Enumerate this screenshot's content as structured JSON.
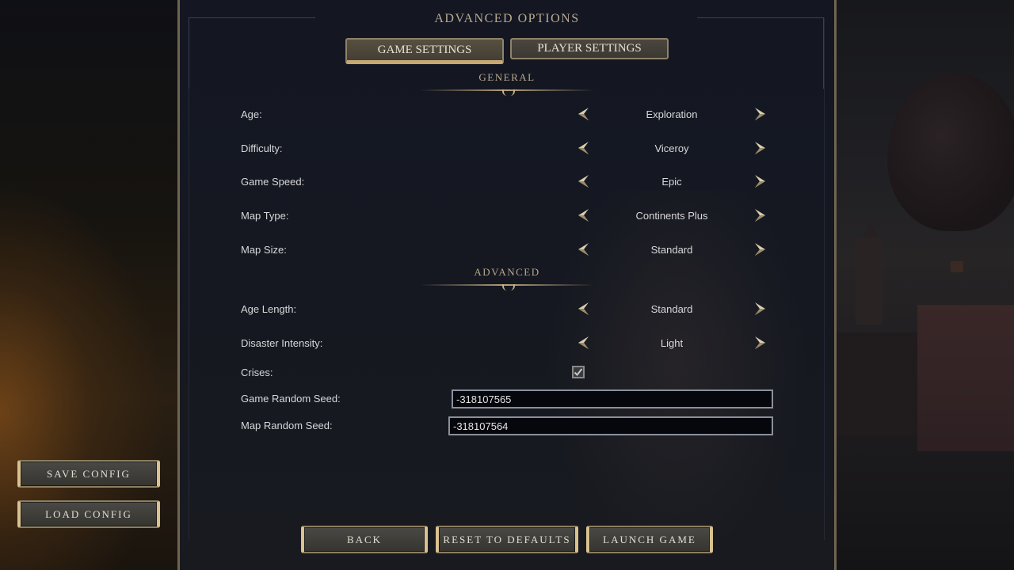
{
  "page": {
    "title": "ADVANCED OPTIONS"
  },
  "tabs": [
    {
      "label": "GAME SETTINGS",
      "active": true
    },
    {
      "label": "PLAYER SETTINGS",
      "active": false
    }
  ],
  "sections": {
    "general": "GENERAL",
    "advanced": "ADVANCED"
  },
  "general_settings": [
    {
      "label": "Age:",
      "value": "Exploration"
    },
    {
      "label": "Difficulty:",
      "value": "Viceroy"
    },
    {
      "label": "Game Speed:",
      "value": "Epic"
    },
    {
      "label": "Map Type:",
      "value": "Continents Plus"
    },
    {
      "label": "Map Size:",
      "value": "Standard"
    }
  ],
  "advanced_settings": [
    {
      "label": "Age Length:",
      "value": "Standard"
    },
    {
      "label": "Disaster Intensity:",
      "value": "Light"
    }
  ],
  "crises": {
    "label": "Crises:",
    "checked": true
  },
  "seeds": {
    "game_label": "Game Random Seed:",
    "game_value": "-318107565",
    "map_label": "Map Random Seed:",
    "map_value": "-318107564"
  },
  "side_buttons": {
    "save": "SAVE CONFIG",
    "load": "LOAD CONFIG"
  },
  "footer_buttons": {
    "back": "BACK",
    "reset": "RESET TO DEFAULTS",
    "launch": "LAUNCH GAME"
  },
  "icons": {
    "prev": "chevron-left-icon",
    "next": "chevron-right-icon",
    "check": "check-icon"
  },
  "colors": {
    "accent_gold": "#c5a874",
    "panel_bg": "#141722",
    "text": "#d8d8da"
  }
}
